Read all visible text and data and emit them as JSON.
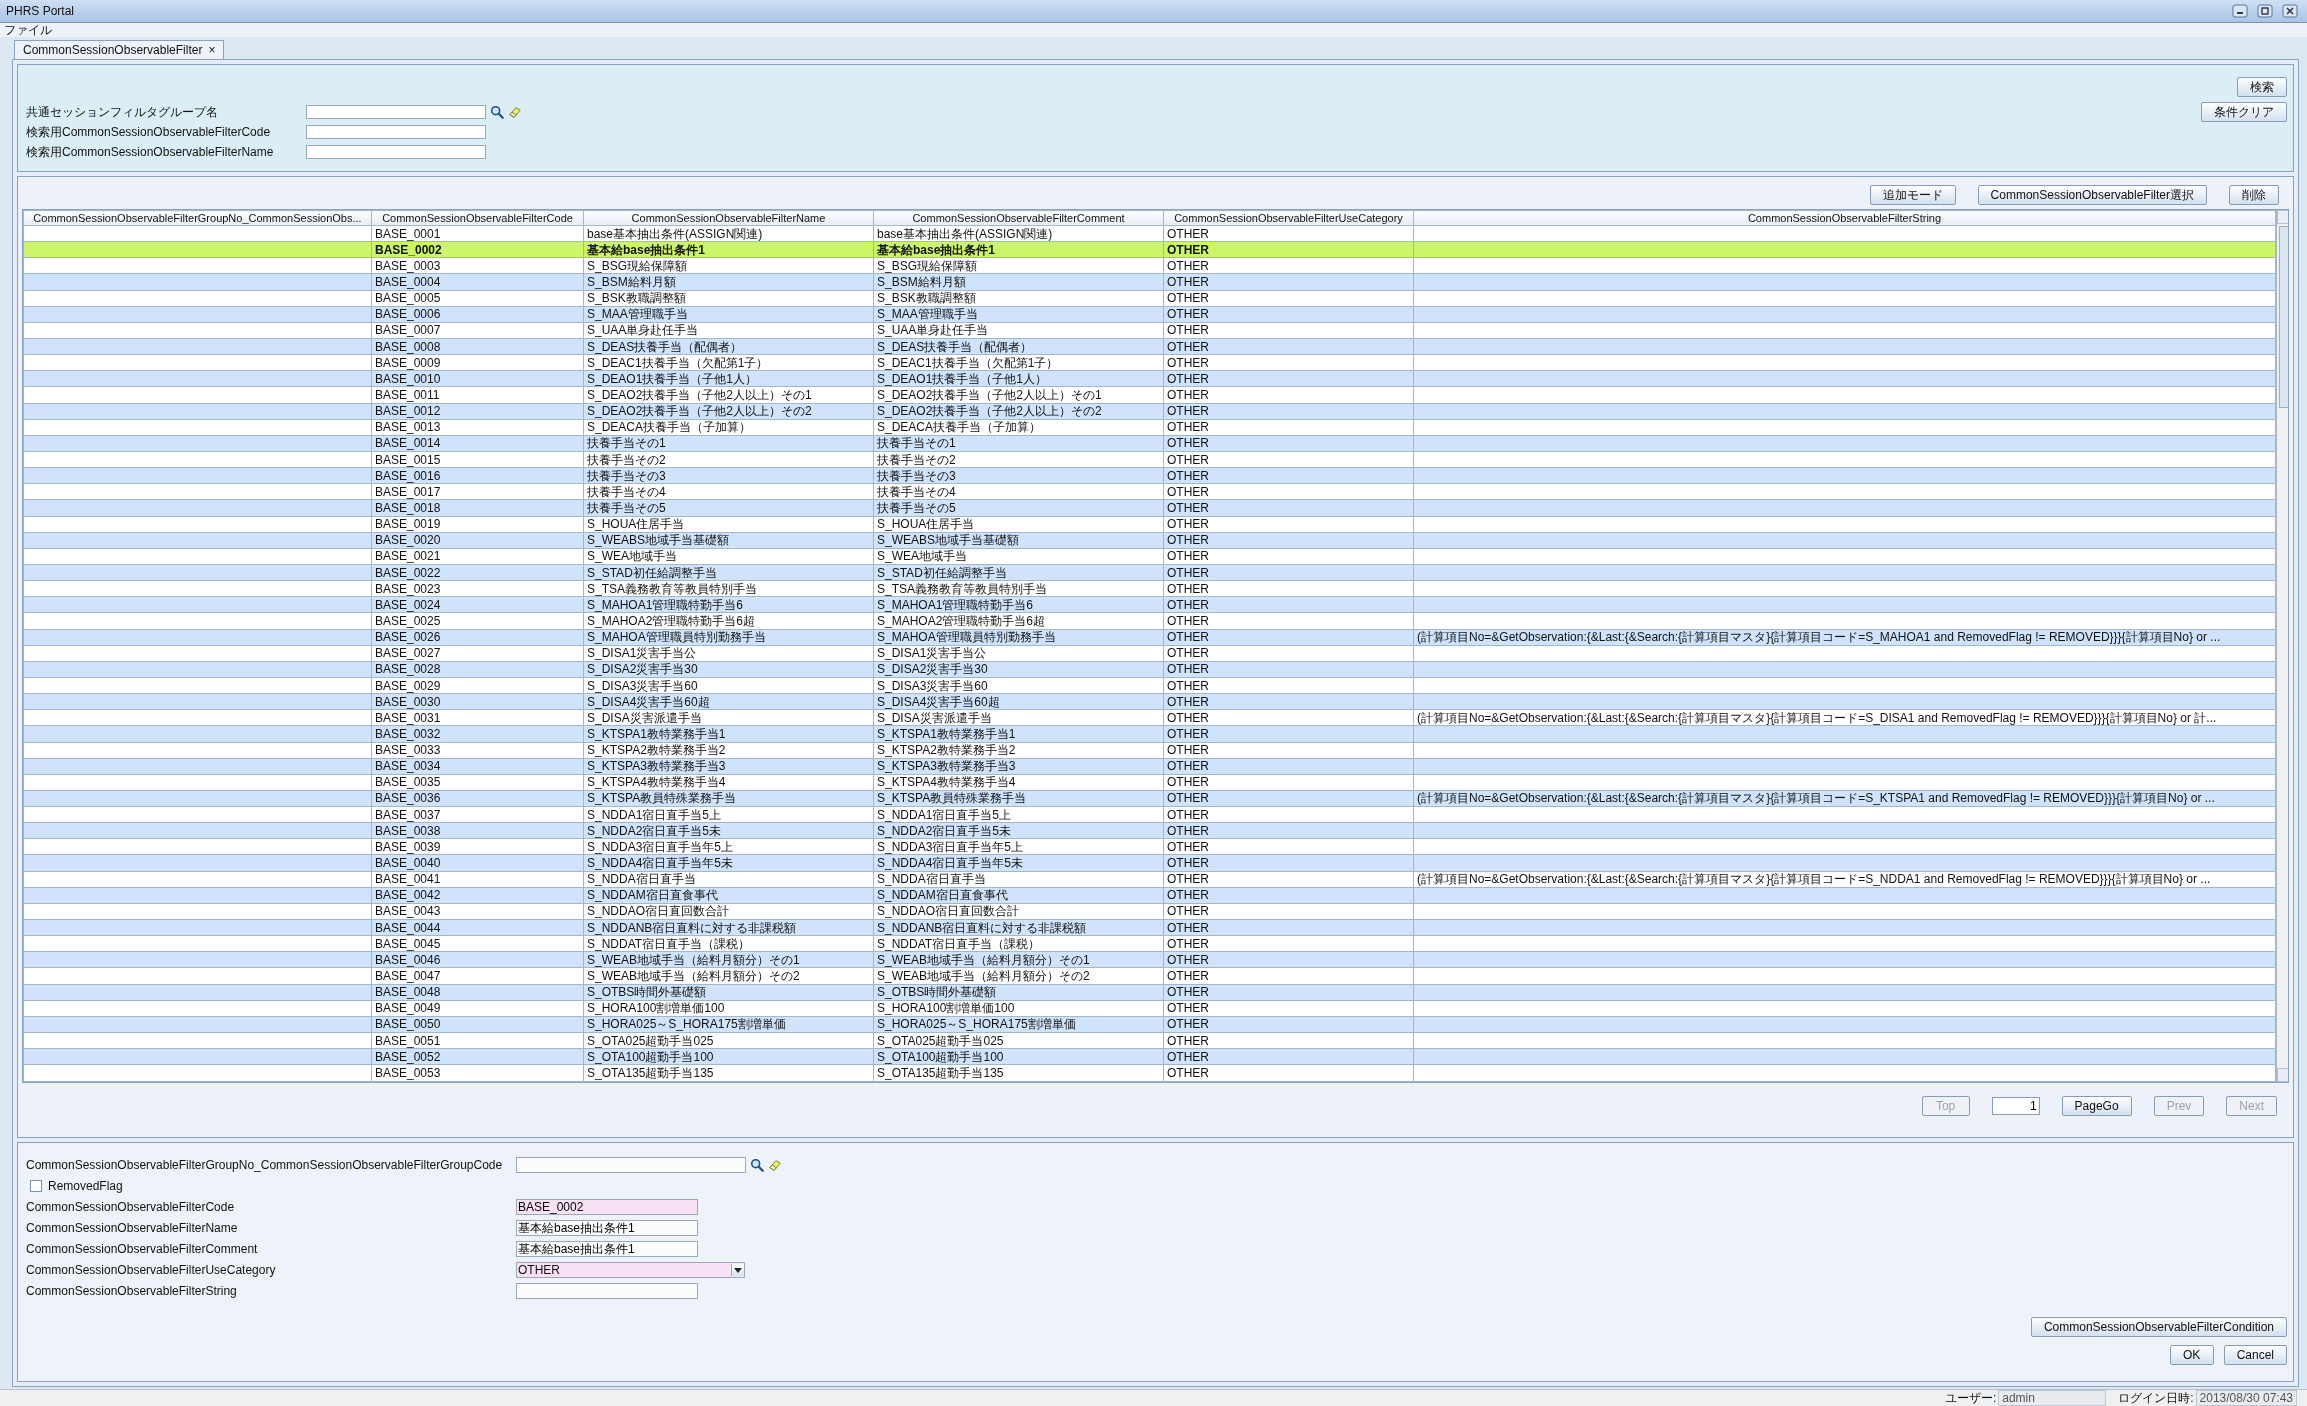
{
  "window": {
    "title": "PHRS Portal"
  },
  "menu": [
    "ファイル"
  ],
  "tabs": [
    {
      "label": "CommonSessionObservableFilter",
      "selected": true,
      "close": "×"
    }
  ],
  "search": {
    "fields": [
      {
        "label": "共通セッションフィルタグループ名",
        "kind": "lookup"
      },
      {
        "label": "検索用CommonSessionObservableFilterCode",
        "kind": "text"
      },
      {
        "label": "検索用CommonSessionObservableFilterName",
        "kind": "text"
      }
    ],
    "buttons": [
      "検索",
      "条件クリア"
    ]
  },
  "table": {
    "buttons": [
      "追加モード",
      "CommonSessionObservableFilter選択",
      "削除"
    ],
    "columns": [
      "CommonSessionObservableFilterGroupNo_CommonSessionObs...",
      "CommonSessionObservableFilterCode",
      "CommonSessionObservableFilterName",
      "CommonSessionObservableFilterComment",
      "CommonSessionObservableFilterUseCategory",
      "CommonSessionObservableFilterString"
    ],
    "rows": [
      {
        "code": "BASE_0001",
        "name": "base基本抽出条件(ASSIGN関連)",
        "comment": "base基本抽出条件(ASSIGN関連)",
        "category": "OTHER",
        "selected": false
      },
      {
        "code": "BASE_0002",
        "name": "基本給base抽出条件1",
        "comment": "基本給base抽出条件1",
        "category": "OTHER",
        "selected": true
      },
      {
        "code": "BASE_0003",
        "name": "S_BSG現給保障額",
        "comment": "S_BSG現給保障額",
        "category": "OTHER",
        "selected": false
      },
      {
        "code": "BASE_0004",
        "name": "S_BSM給料月額",
        "comment": "S_BSM給料月額",
        "category": "OTHER",
        "selected": false
      },
      {
        "code": "BASE_0005",
        "name": "S_BSK教職調整額",
        "comment": "S_BSK教職調整額",
        "category": "OTHER",
        "selected": false
      },
      {
        "code": "BASE_0006",
        "name": "S_MAA管理職手当",
        "comment": "S_MAA管理職手当",
        "category": "OTHER",
        "selected": false
      },
      {
        "code": "BASE_0007",
        "name": "S_UAA単身赴任手当",
        "comment": "S_UAA単身赴任手当",
        "category": "OTHER",
        "selected": false
      },
      {
        "code": "BASE_0008",
        "name": "S_DEAS扶養手当（配偶者）",
        "comment": "S_DEAS扶養手当（配偶者）",
        "category": "OTHER",
        "selected": false
      },
      {
        "code": "BASE_0009",
        "name": "S_DEAC1扶養手当（欠配第1子）",
        "comment": "S_DEAC1扶養手当（欠配第1子）",
        "category": "OTHER",
        "selected": false
      },
      {
        "code": "BASE_0010",
        "name": "S_DEAO1扶養手当（子他1人）",
        "comment": "S_DEAO1扶養手当（子他1人）",
        "category": "OTHER",
        "selected": false
      },
      {
        "code": "BASE_0011",
        "name": "S_DEAO2扶養手当（子他2人以上）その1",
        "comment": "S_DEAO2扶養手当（子他2人以上）その1",
        "category": "OTHER",
        "selected": false
      },
      {
        "code": "BASE_0012",
        "name": "S_DEAO2扶養手当（子他2人以上）その2",
        "comment": "S_DEAO2扶養手当（子他2人以上）その2",
        "category": "OTHER",
        "selected": false
      },
      {
        "code": "BASE_0013",
        "name": "S_DEACA扶養手当（子加算）",
        "comment": "S_DEACA扶養手当（子加算）",
        "category": "OTHER",
        "selected": false
      },
      {
        "code": "BASE_0014",
        "name": "扶養手当その1",
        "comment": "扶養手当その1",
        "category": "OTHER",
        "selected": false
      },
      {
        "code": "BASE_0015",
        "name": "扶養手当その2",
        "comment": "扶養手当その2",
        "category": "OTHER",
        "selected": false
      },
      {
        "code": "BASE_0016",
        "name": "扶養手当その3",
        "comment": "扶養手当その3",
        "category": "OTHER",
        "selected": false
      },
      {
        "code": "BASE_0017",
        "name": "扶養手当その4",
        "comment": "扶養手当その4",
        "category": "OTHER",
        "selected": false
      },
      {
        "code": "BASE_0018",
        "name": "扶養手当その5",
        "comment": "扶養手当その5",
        "category": "OTHER",
        "selected": false
      },
      {
        "code": "BASE_0019",
        "name": "S_HOUA住居手当",
        "comment": "S_HOUA住居手当",
        "category": "OTHER",
        "selected": false
      },
      {
        "code": "BASE_0020",
        "name": "S_WEABS地域手当基礎額",
        "comment": "S_WEABS地域手当基礎額",
        "category": "OTHER",
        "selected": false
      },
      {
        "code": "BASE_0021",
        "name": "S_WEA地域手当",
        "comment": "S_WEA地域手当",
        "category": "OTHER",
        "selected": false
      },
      {
        "code": "BASE_0022",
        "name": "S_STAD初任給調整手当",
        "comment": "S_STAD初任給調整手当",
        "category": "OTHER",
        "selected": false
      },
      {
        "code": "BASE_0023",
        "name": "S_TSA義務教育等教員特別手当",
        "comment": "S_TSA義務教育等教員特別手当",
        "category": "OTHER",
        "selected": false
      },
      {
        "code": "BASE_0024",
        "name": "S_MAHOA1管理職特勤手当6",
        "comment": "S_MAHOA1管理職特勤手当6",
        "category": "OTHER",
        "selected": false
      },
      {
        "code": "BASE_0025",
        "name": "S_MAHOA2管理職特勤手当6超",
        "comment": "S_MAHOA2管理職特勤手当6超",
        "category": "OTHER",
        "selected": false
      },
      {
        "code": "BASE_0026",
        "name": "S_MAHOA管理職員特別勤務手当",
        "comment": "S_MAHOA管理職員特別勤務手当",
        "category": "OTHER",
        "filter_string": "(計算項目No=&GetObservation:{&Last:{&Search:{計算項目マスタ}{計算項目コード=S_MAHOA1 and RemovedFlag != REMOVED}}}{計算項目No} or ...",
        "selected": false
      },
      {
        "code": "BASE_0027",
        "name": "S_DISA1災害手当公",
        "comment": "S_DISA1災害手当公",
        "category": "OTHER",
        "selected": false
      },
      {
        "code": "BASE_0028",
        "name": "S_DISA2災害手当30",
        "comment": "S_DISA2災害手当30",
        "category": "OTHER",
        "selected": false
      },
      {
        "code": "BASE_0029",
        "name": "S_DISA3災害手当60",
        "comment": "S_DISA3災害手当60",
        "category": "OTHER",
        "selected": false
      },
      {
        "code": "BASE_0030",
        "name": "S_DISA4災害手当60超",
        "comment": "S_DISA4災害手当60超",
        "category": "OTHER",
        "selected": false
      },
      {
        "code": "BASE_0031",
        "name": "S_DISA災害派遣手当",
        "comment": "S_DISA災害派遣手当",
        "category": "OTHER",
        "filter_string": "(計算項目No=&GetObservation:{&Last:{&Search:{計算項目マスタ}{計算項目コード=S_DISA1 and RemovedFlag != REMOVED}}}{計算項目No} or 計...",
        "selected": false
      },
      {
        "code": "BASE_0032",
        "name": "S_KTSPA1教特業務手当1",
        "comment": "S_KTSPA1教特業務手当1",
        "category": "OTHER",
        "selected": false
      },
      {
        "code": "BASE_0033",
        "name": "S_KTSPA2教特業務手当2",
        "comment": "S_KTSPA2教特業務手当2",
        "category": "OTHER",
        "selected": false
      },
      {
        "code": "BASE_0034",
        "name": "S_KTSPA3教特業務手当3",
        "comment": "S_KTSPA3教特業務手当3",
        "category": "OTHER",
        "selected": false
      },
      {
        "code": "BASE_0035",
        "name": "S_KTSPA4教特業務手当4",
        "comment": "S_KTSPA4教特業務手当4",
        "category": "OTHER",
        "selected": false
      },
      {
        "code": "BASE_0036",
        "name": "S_KTSPA教員特殊業務手当",
        "comment": "S_KTSPA教員特殊業務手当",
        "category": "OTHER",
        "filter_string": "(計算項目No=&GetObservation:{&Last:{&Search:{計算項目マスタ}{計算項目コード=S_KTSPA1 and RemovedFlag != REMOVED}}}{計算項目No} or ...",
        "selected": false
      },
      {
        "code": "BASE_0037",
        "name": "S_NDDA1宿日直手当5上",
        "comment": "S_NDDA1宿日直手当5上",
        "category": "OTHER",
        "selected": false
      },
      {
        "code": "BASE_0038",
        "name": "S_NDDA2宿日直手当5未",
        "comment": "S_NDDA2宿日直手当5未",
        "category": "OTHER",
        "selected": false
      },
      {
        "code": "BASE_0039",
        "name": "S_NDDA3宿日直手当年5上",
        "comment": "S_NDDA3宿日直手当年5上",
        "category": "OTHER",
        "selected": false
      },
      {
        "code": "BASE_0040",
        "name": "S_NDDA4宿日直手当年5未",
        "comment": "S_NDDA4宿日直手当年5未",
        "category": "OTHER",
        "selected": false
      },
      {
        "code": "BASE_0041",
        "name": "S_NDDA宿日直手当",
        "comment": "S_NDDA宿日直手当",
        "category": "OTHER",
        "filter_string": "(計算項目No=&GetObservation:{&Last:{&Search:{計算項目マスタ}{計算項目コード=S_NDDA1 and RemovedFlag != REMOVED}}}{計算項目No} or ...",
        "selected": false
      },
      {
        "code": "BASE_0042",
        "name": "S_NDDAM宿日直食事代",
        "comment": "S_NDDAM宿日直食事代",
        "category": "OTHER",
        "selected": false
      },
      {
        "code": "BASE_0043",
        "name": "S_NDDAO宿日直回数合計",
        "comment": "S_NDDAO宿日直回数合計",
        "category": "OTHER",
        "selected": false
      },
      {
        "code": "BASE_0044",
        "name": "S_NDDANB宿日直料に対する非課税額",
        "comment": "S_NDDANB宿日直料に対する非課税額",
        "category": "OTHER",
        "selected": false
      },
      {
        "code": "BASE_0045",
        "name": "S_NDDAT宿日直手当（課税）",
        "comment": "S_NDDAT宿日直手当（課税）",
        "category": "OTHER",
        "selected": false
      },
      {
        "code": "BASE_0046",
        "name": "S_WEAB地域手当（給料月額分）その1",
        "comment": "S_WEAB地域手当（給料月額分）その1",
        "category": "OTHER",
        "selected": false
      },
      {
        "code": "BASE_0047",
        "name": "S_WEAB地域手当（給料月額分）その2",
        "comment": "S_WEAB地域手当（給料月額分）その2",
        "category": "OTHER",
        "selected": false
      },
      {
        "code": "BASE_0048",
        "name": "S_OTBS時間外基礎額",
        "comment": "S_OTBS時間外基礎額",
        "category": "OTHER",
        "selected": false
      },
      {
        "code": "BASE_0049",
        "name": "S_HORA100割増単価100",
        "comment": "S_HORA100割増単価100",
        "category": "OTHER",
        "selected": false
      },
      {
        "code": "BASE_0050",
        "name": "S_HORA025～S_HORA175割増単価",
        "comment": "S_HORA025～S_HORA175割増単価",
        "category": "OTHER",
        "selected": false
      },
      {
        "code": "BASE_0051",
        "name": "S_OTA025超勤手当025",
        "comment": "S_OTA025超勤手当025",
        "category": "OTHER",
        "selected": false
      },
      {
        "code": "BASE_0052",
        "name": "S_OTA100超勤手当100",
        "comment": "S_OTA100超勤手当100",
        "category": "OTHER",
        "selected": false
      },
      {
        "code": "BASE_0053",
        "name": "S_OTA135超勤手当135",
        "comment": "S_OTA135超勤手当135",
        "category": "OTHER",
        "selected": false
      }
    ]
  },
  "pagination": [
    {
      "kind": "button",
      "label": "Top",
      "disabled": true
    },
    {
      "kind": "field",
      "value": "1"
    },
    {
      "kind": "button",
      "label": "PageGo",
      "disabled": false
    },
    {
      "kind": "button",
      "label": "Prev",
      "disabled": true
    },
    {
      "kind": "button",
      "label": "Next",
      "disabled": true
    }
  ],
  "form": {
    "fields": [
      {
        "kind": "lookup",
        "label": "CommonSessionObservableFilterGroupNo_CommonSessionObservableFilterGroupCode",
        "required": false
      },
      {
        "kind": "checkbox",
        "label": "RemovedFlag",
        "checked": false
      },
      {
        "kind": "text",
        "label": "CommonSessionObservableFilterCode",
        "value": "BASE_0002",
        "required": true
      },
      {
        "kind": "text",
        "label": "CommonSessionObservableFilterName",
        "value": "基本給base抽出条件1",
        "required": false
      },
      {
        "kind": "text",
        "label": "CommonSessionObservableFilterComment",
        "value": "基本給base抽出条件1",
        "required": false
      },
      {
        "kind": "select",
        "label": "CommonSessionObservableFilterUseCategory",
        "value": "OTHER",
        "required": true
      },
      {
        "kind": "text",
        "label": "CommonSessionObservableFilterString",
        "required": false
      }
    ],
    "condition_button": "CommonSessionObservableFilterCondition",
    "buttons": [
      "OK",
      "Cancel"
    ]
  },
  "status_bar": {
    "user_label": "ユーザー:",
    "user": "admin",
    "login_label": "ログイン日時:",
    "login": "2013/08/30 07:43"
  }
}
